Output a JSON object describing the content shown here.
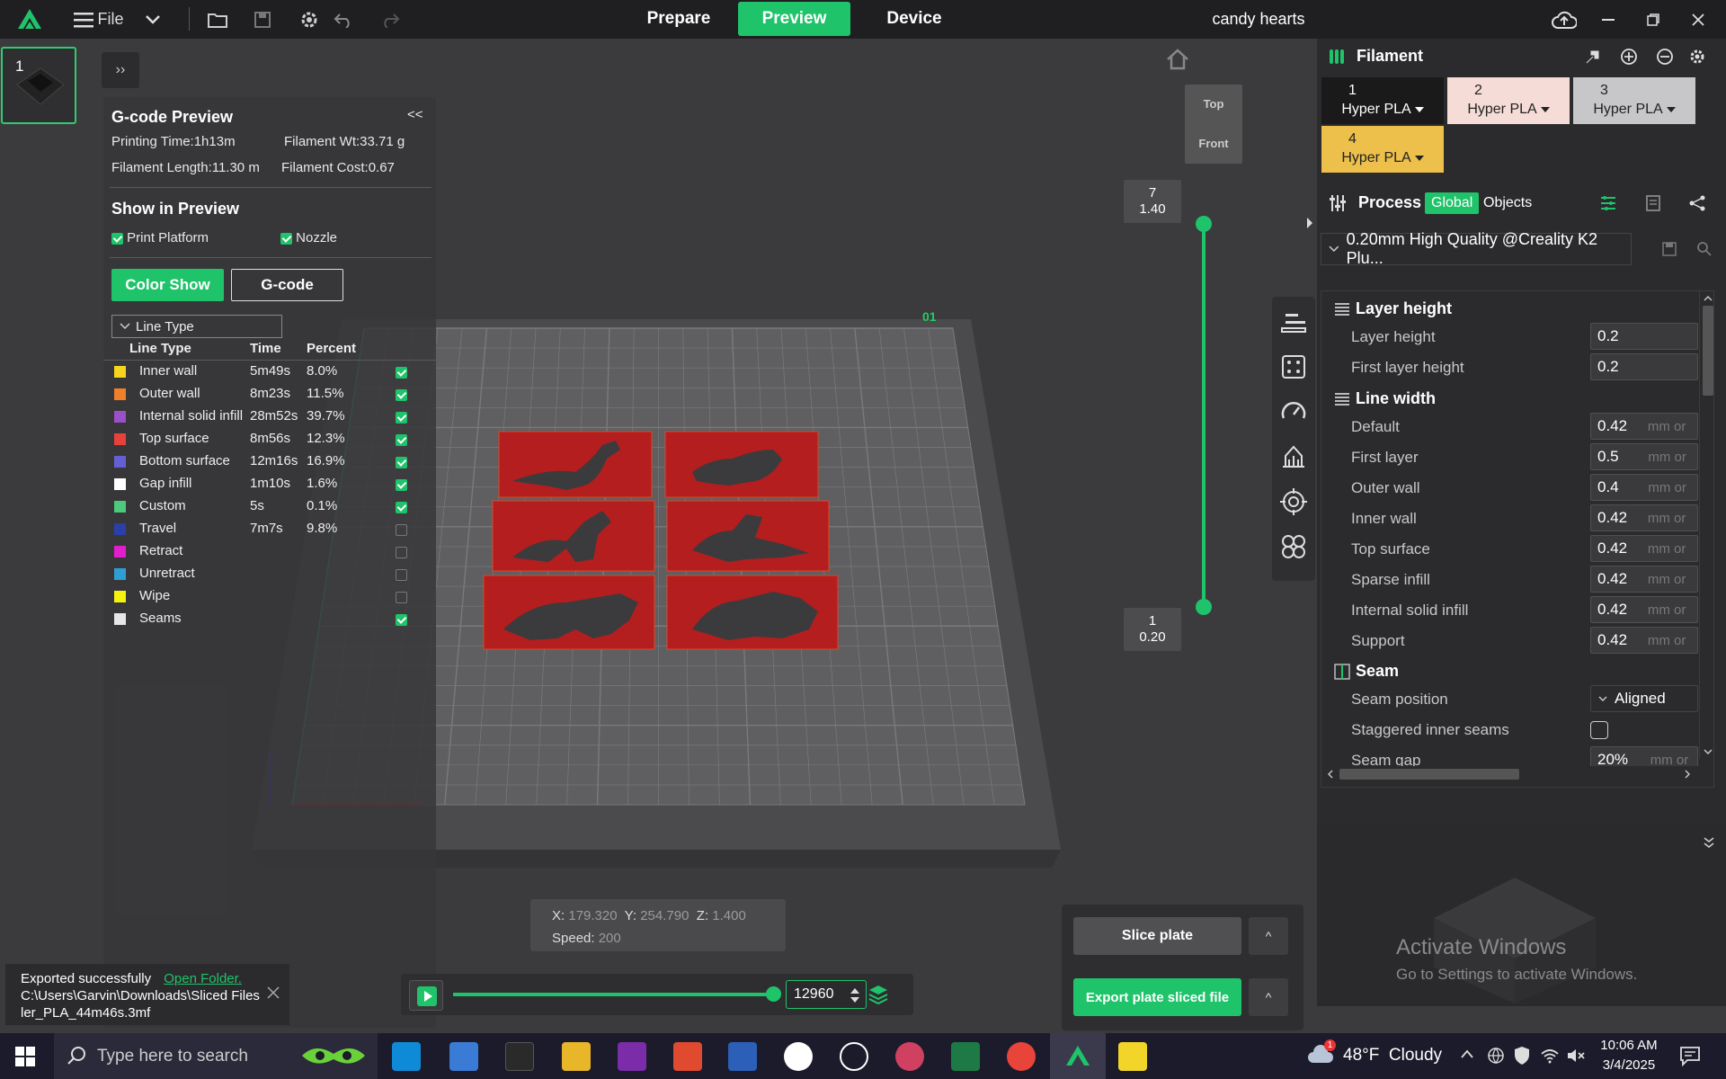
{
  "topbar": {
    "file_label": "File",
    "tabs": {
      "prepare": "Prepare",
      "preview": "Preview",
      "device": "Device"
    },
    "project_title": "candy hearts"
  },
  "thumbnail": {
    "plate_number": "1"
  },
  "gcode_preview": {
    "title": "G-code Preview",
    "printing_time": "Printing Time:1h13m",
    "filament_wt": "Filament Wt:33.71 g",
    "filament_length": "Filament Length:11.30 m",
    "filament_cost": "Filament Cost:0.67",
    "collapse_label": "<<",
    "show_in_preview": "Show in Preview",
    "print_platform": "Print Platform",
    "nozzle": "Nozzle",
    "color_show": "Color Show",
    "gcode": "G-code",
    "line_type_select": "Line Type",
    "headers": {
      "type": "Line Type",
      "time": "Time",
      "percent": "Percent"
    },
    "rows": [
      {
        "name": "Inner wall",
        "time": "5m49s",
        "percent": "8.0%",
        "color": "#f5d61c",
        "checked": true
      },
      {
        "name": "Outer wall",
        "time": "8m23s",
        "percent": "11.5%",
        "color": "#f07f2a",
        "checked": true
      },
      {
        "name": "Internal solid infill",
        "time": "28m52s",
        "percent": "39.7%",
        "color": "#9b4fc8",
        "checked": true
      },
      {
        "name": "Top surface",
        "time": "8m56s",
        "percent": "12.3%",
        "color": "#e8413a",
        "checked": true
      },
      {
        "name": "Bottom surface",
        "time": "12m16s",
        "percent": "16.9%",
        "color": "#6460d4",
        "checked": true
      },
      {
        "name": "Gap infill",
        "time": "1m10s",
        "percent": "1.6%",
        "color": "#ffffff",
        "checked": true
      },
      {
        "name": "Custom",
        "time": "5s",
        "percent": "0.1%",
        "color": "#4cc97a",
        "checked": true
      },
      {
        "name": "Travel",
        "time": "7m7s",
        "percent": "9.8%",
        "color": "#2a3fa8",
        "checked": false
      },
      {
        "name": "Retract",
        "time": "",
        "percent": "",
        "color": "#e21ecb",
        "checked": false
      },
      {
        "name": "Unretract",
        "time": "",
        "percent": "",
        "color": "#2e9fd4",
        "checked": false
      },
      {
        "name": "Wipe",
        "time": "",
        "percent": "",
        "color": "#f5f20e",
        "checked": false
      },
      {
        "name": "Seams",
        "time": "",
        "percent": "",
        "color": "#e6e6e6",
        "checked": true
      }
    ]
  },
  "viewcube": {
    "top": "Top",
    "front": "Front"
  },
  "layer_slider": {
    "top_layer": "7",
    "top_height": "1.40",
    "bottom_layer": "1",
    "bottom_height": "0.20"
  },
  "bed_label": "01",
  "coords": {
    "x_label": "X:",
    "x": "179.320",
    "y_label": "Y:",
    "y": "254.790",
    "z_label": "Z:",
    "z": "1.400",
    "speed_label": "Speed:",
    "speed": "200"
  },
  "move_slider": {
    "value": "12960"
  },
  "slice": {
    "slice_plate": "Slice plate",
    "export": "Export plate sliced file",
    "caret": "^"
  },
  "toast": {
    "message": "Exported successfully",
    "link": "Open Folder.",
    "path_line1": "C:\\Users\\Garvin\\Downloads\\Sliced File",
    "path_suffix": "s",
    "path_line2": "ler_PLA_44m46s.3mf"
  },
  "filament": {
    "title": "Filament",
    "slots": [
      {
        "num": "1",
        "name": "Hyper PLA",
        "bg": "#1a1a1a",
        "fg": "#ffffff"
      },
      {
        "num": "2",
        "name": "Hyper PLA",
        "bg": "#f6dcd6",
        "fg": "#222222"
      },
      {
        "num": "3",
        "name": "Hyper PLA",
        "bg": "#c7c7c9",
        "fg": "#222222"
      },
      {
        "num": "4",
        "name": "Hyper PLA",
        "bg": "#ecc04a",
        "fg": "#222222"
      }
    ]
  },
  "process": {
    "title": "Process",
    "global": "Global",
    "objects": "Objects",
    "preset": "0.20mm High Quality @Creality K2 Plu..."
  },
  "params": {
    "layer_height_section": "Layer height",
    "layer_height_label": "Layer height",
    "layer_height": "0.2",
    "first_layer_height_label": "First layer height",
    "first_layer_height": "0.2",
    "line_width_section": "Line width",
    "default_label": "Default",
    "default": "0.42",
    "first_layer_label": "First layer",
    "first_layer": "0.5",
    "outer_wall_label": "Outer wall",
    "outer_wall": "0.4",
    "inner_wall_label": "Inner wall",
    "inner_wall": "0.42",
    "top_surface_label": "Top surface",
    "top_surface": "0.42",
    "sparse_infill_label": "Sparse infill",
    "sparse_infill": "0.42",
    "internal_solid_label": "Internal solid infill",
    "internal_solid": "0.42",
    "support_label": "Support",
    "support": "0.42",
    "unit": "mm or",
    "seam_section": "Seam",
    "seam_position_label": "Seam position",
    "seam_position": "Aligned",
    "staggered_label": "Staggered inner seams",
    "seam_gap_label": "Seam gap",
    "seam_gap": "20%"
  },
  "watermark": {
    "line1": "Activate Windows",
    "line2": "Go to Settings to activate Windows."
  },
  "taskbar": {
    "search_placeholder": "Type here to search",
    "weather": "48°F  Cloudy",
    "weather_badge": "1",
    "time": "10:06 AM",
    "date": "3/4/2025"
  }
}
